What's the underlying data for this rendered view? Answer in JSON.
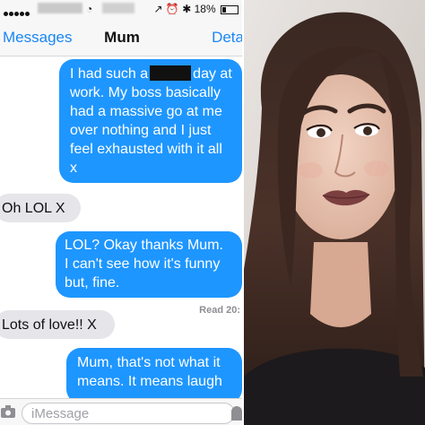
{
  "status": {
    "battery": "18%",
    "wifi_icon": "wifi-icon",
    "bluetooth_icon": "bluetooth-icon"
  },
  "nav": {
    "back_label": "Messages",
    "title": "Mum",
    "details_label": "Deta"
  },
  "messages": [
    {
      "from": "me",
      "lines": [
        "I had such a",
        "day at",
        "work. My boss basically",
        "had a massive go at me",
        "over nothing and I just",
        "feel exhausted with it all",
        "x"
      ]
    },
    {
      "from": "mum",
      "text": "Oh LOL X"
    },
    {
      "from": "me",
      "lines": [
        "LOL? Okay thanks Mum.",
        "I can't see how it's funny",
        "but, fine."
      ]
    },
    {
      "from": "mum",
      "text": "Lots of love!! X"
    },
    {
      "from": "me",
      "lines": [
        "Mum, that's not what it",
        "means. It means laugh"
      ]
    }
  ],
  "read_receipt": "Read 20:",
  "input": {
    "placeholder": "iMessage"
  },
  "colors": {
    "sent_bubble": "#1e96ff",
    "received_bubble": "#e5e5ea",
    "accent": "#1a87f5"
  }
}
